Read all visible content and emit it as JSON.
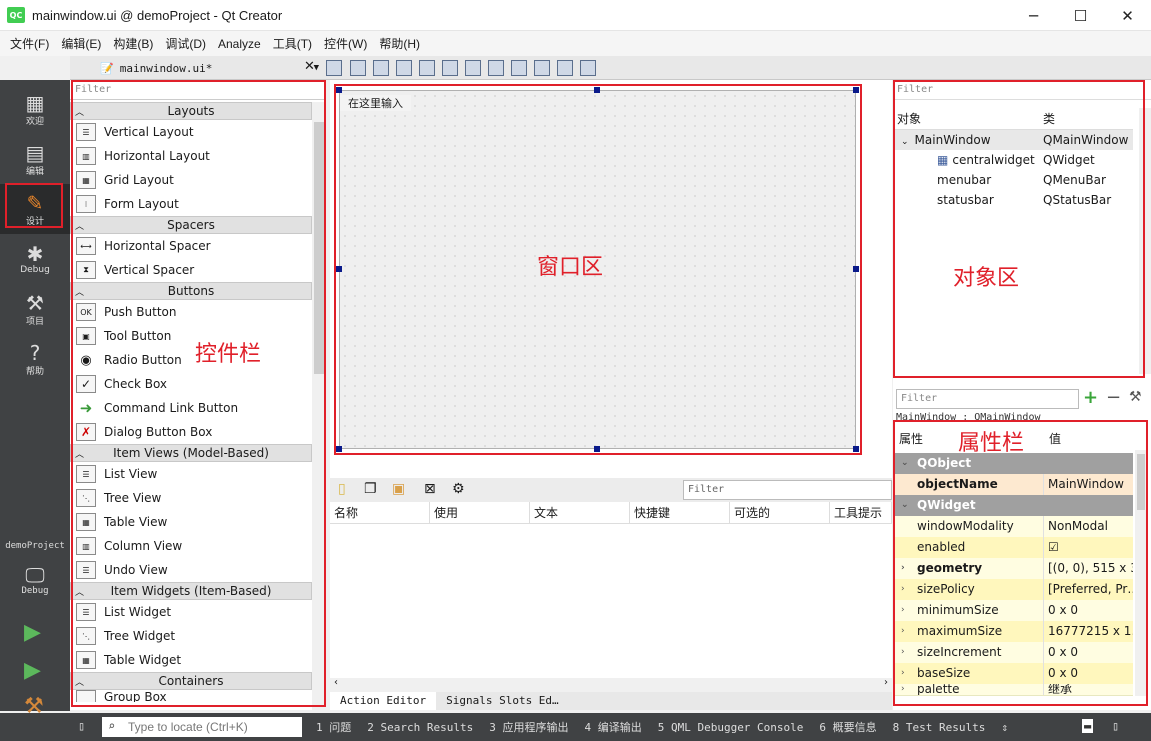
{
  "window": {
    "logo": "QC",
    "title": "mainwindow.ui @ demoProject - Qt Creator",
    "controls": [
      "─",
      "☐",
      "✕"
    ]
  },
  "menu": [
    "文件(F)",
    "编辑(E)",
    "构建(B)",
    "调试(D)",
    "Analyze",
    "工具(T)",
    "控件(W)",
    "帮助(H)"
  ],
  "modes": [
    {
      "label": "欢迎",
      "icon": "grid-icon"
    },
    {
      "label": "编辑",
      "icon": "document-icon"
    },
    {
      "label": "设计",
      "icon": "pencil-icon"
    },
    {
      "label": "Debug",
      "icon": "bug-icon"
    },
    {
      "label": "项目",
      "icon": "wrench-icon"
    },
    {
      "label": "帮助",
      "icon": "help-icon"
    }
  ],
  "project": {
    "name": "demoProject",
    "kit": "Debug"
  },
  "editor": {
    "file": "mainwindow.ui*"
  },
  "widgetbox": {
    "filter": "Filter",
    "groups": [
      {
        "title": "Layouts",
        "items": [
          "Vertical Layout",
          "Horizontal Layout",
          "Grid Layout",
          "Form Layout"
        ]
      },
      {
        "title": "Spacers",
        "items": [
          "Horizontal Spacer",
          "Vertical Spacer"
        ]
      },
      {
        "title": "Buttons",
        "items": [
          "Push Button",
          "Tool Button",
          "Radio Button",
          "Check Box",
          "Command Link Button",
          "Dialog Button Box"
        ]
      },
      {
        "title": "Item Views (Model-Based)",
        "items": [
          "List View",
          "Tree View",
          "Table View",
          "Column View",
          "Undo View"
        ]
      },
      {
        "title": "Item Widgets (Item-Based)",
        "items": [
          "List Widget",
          "Tree Widget",
          "Table Widget"
        ]
      },
      {
        "title": "Containers",
        "items": [
          "Group Box"
        ]
      }
    ]
  },
  "form": {
    "menu_placeholder": "在这里输入"
  },
  "action_editor": {
    "filter": "Filter",
    "columns": [
      "名称",
      "使用",
      "文本",
      "快捷键",
      "可选的",
      "工具提示"
    ],
    "tabs": [
      "Action Editor",
      "Signals  Slots Ed…"
    ]
  },
  "object_inspector": {
    "filter": "Filter",
    "columns": [
      "对象",
      "类"
    ],
    "rows": [
      {
        "name": "MainWindow",
        "cls": "QMainWindow"
      },
      {
        "name": "centralwidget",
        "cls": "QWidget"
      },
      {
        "name": "menubar",
        "cls": "QMenuBar"
      },
      {
        "name": "statusbar",
        "cls": "QStatusBar"
      }
    ]
  },
  "property_editor": {
    "filter": "Filter",
    "class_line": "MainWindow : QMainWindow",
    "columns": [
      "属性",
      "值"
    ],
    "rows": [
      {
        "name": "QObject",
        "value": "",
        "section": true
      },
      {
        "name": "objectName",
        "value": "MainWindow"
      },
      {
        "name": "QWidget",
        "value": "",
        "section": true
      },
      {
        "name": "windowModality",
        "value": "NonModal"
      },
      {
        "name": "enabled",
        "value": "☑"
      },
      {
        "name": "geometry",
        "value": "[(0, 0), 515 x 3…"
      },
      {
        "name": "sizePolicy",
        "value": "[Preferred, Pr…"
      },
      {
        "name": "minimumSize",
        "value": "0 x 0"
      },
      {
        "name": "maximumSize",
        "value": "16777215 x 1…"
      },
      {
        "name": "sizeIncrement",
        "value": "0 x 0"
      },
      {
        "name": "baseSize",
        "value": "0 x 0"
      },
      {
        "name": "palette",
        "value": "继承"
      }
    ]
  },
  "statusbar": {
    "locator": "Type to locate (Ctrl+K)",
    "items": [
      "1 问题",
      "2 Search Results",
      "3 应用程序输出",
      "4 编译输出",
      "5 QML Debugger Console",
      "6 概要信息",
      "8 Test Results"
    ]
  },
  "annotations": {
    "widgets": "控件栏",
    "window": "窗口区",
    "objects": "对象区",
    "properties": "属性栏",
    "color": "#e0202a"
  }
}
